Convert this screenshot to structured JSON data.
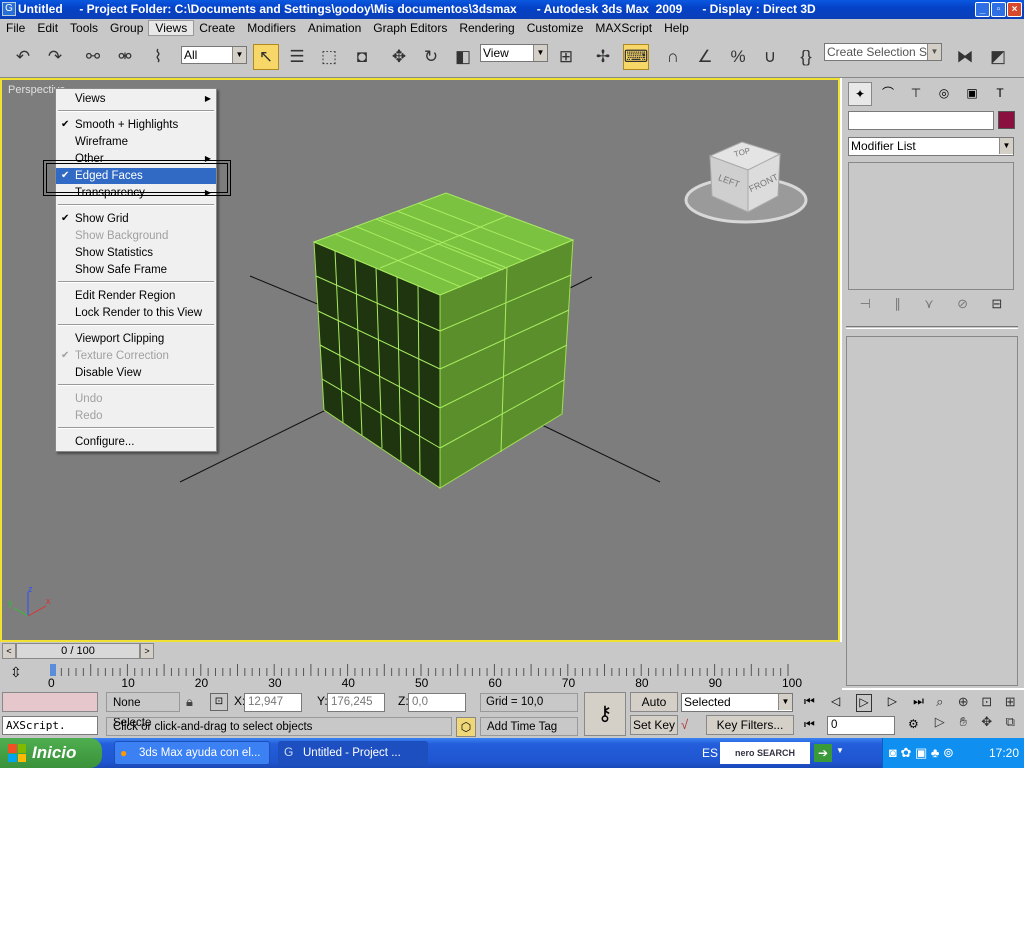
{
  "window": {
    "title": "Untitled     - Project Folder: C:\\Documents and Settings\\godoy\\Mis documentos\\3dsmax      - Autodesk 3ds Max  2009      - Display : Direct 3D",
    "icon": "3dsmax-icon"
  },
  "menubar": [
    "File",
    "Edit",
    "Tools",
    "Group",
    "Views",
    "Create",
    "Modifiers",
    "Animation",
    "Graph Editors",
    "Rendering",
    "Customize",
    "MAXScript",
    "Help"
  ],
  "menubar_active": "Views",
  "toolbar": {
    "filter": "All",
    "ref_coord": "View",
    "selection_set_placeholder": "Create Selection Set"
  },
  "viewport": {
    "label": "Perspective",
    "viewcube": {
      "top": "TOP",
      "left": "LEFT",
      "front": "FRONT"
    },
    "axis": {
      "x": "x",
      "y": "y",
      "z": "z"
    },
    "object_color": "#7cc241",
    "border_color": "#f0e030"
  },
  "context_menu": {
    "items": [
      {
        "label": "Views",
        "submenu": true
      },
      {
        "label": "Smooth + Highlights",
        "checked": true
      },
      {
        "label": "Wireframe"
      },
      {
        "label": "Other",
        "submenu": true
      },
      {
        "label": "Edged Faces",
        "checked": true,
        "highlighted": true
      },
      {
        "label": "Transparency",
        "submenu": true
      },
      {
        "label": "Show Grid",
        "checked": true
      },
      {
        "label": "Show Background",
        "disabled": true
      },
      {
        "label": "Show Statistics"
      },
      {
        "label": "Show Safe Frame"
      },
      {
        "label": "Edit Render Region"
      },
      {
        "label": "Lock Render to this View"
      },
      {
        "label": "Viewport Clipping"
      },
      {
        "label": "Texture Correction",
        "checked": true,
        "disabled": true
      },
      {
        "label": "Disable View"
      },
      {
        "label": "Undo",
        "disabled": true
      },
      {
        "label": "Redo",
        "disabled": true
      },
      {
        "label": "Configure..."
      }
    ]
  },
  "command_panel": {
    "modifier_list": "Modifier List",
    "color_swatch": "#8a1040"
  },
  "timeline": {
    "frame": "0 / 100",
    "ticks": [
      "0",
      "10",
      "20",
      "30",
      "40",
      "50",
      "60",
      "70",
      "80",
      "90",
      "100"
    ]
  },
  "status": {
    "selection": "None Selecte",
    "x_label": "X:",
    "x": "12,947",
    "y_label": "Y:",
    "y": "176,245",
    "z_label": "Z:",
    "z": "0,0",
    "grid": "Grid = 10,0",
    "prompt": "Click or click-and-drag to select objects",
    "add_time_tag": "Add Time Tag",
    "auto_key": "Auto Key",
    "set_key": "Set Key",
    "key_mode": "Selected",
    "key_filters": "Key Filters...",
    "frame_value": "0",
    "maxscript": "AXScript."
  },
  "taskbar": {
    "start": "Inicio",
    "tasks": [
      "3ds Max ayuda con el...",
      "Untitled      - Project ..."
    ],
    "lang": "ES",
    "search": "nero SEARCH",
    "clock": "17:20"
  }
}
